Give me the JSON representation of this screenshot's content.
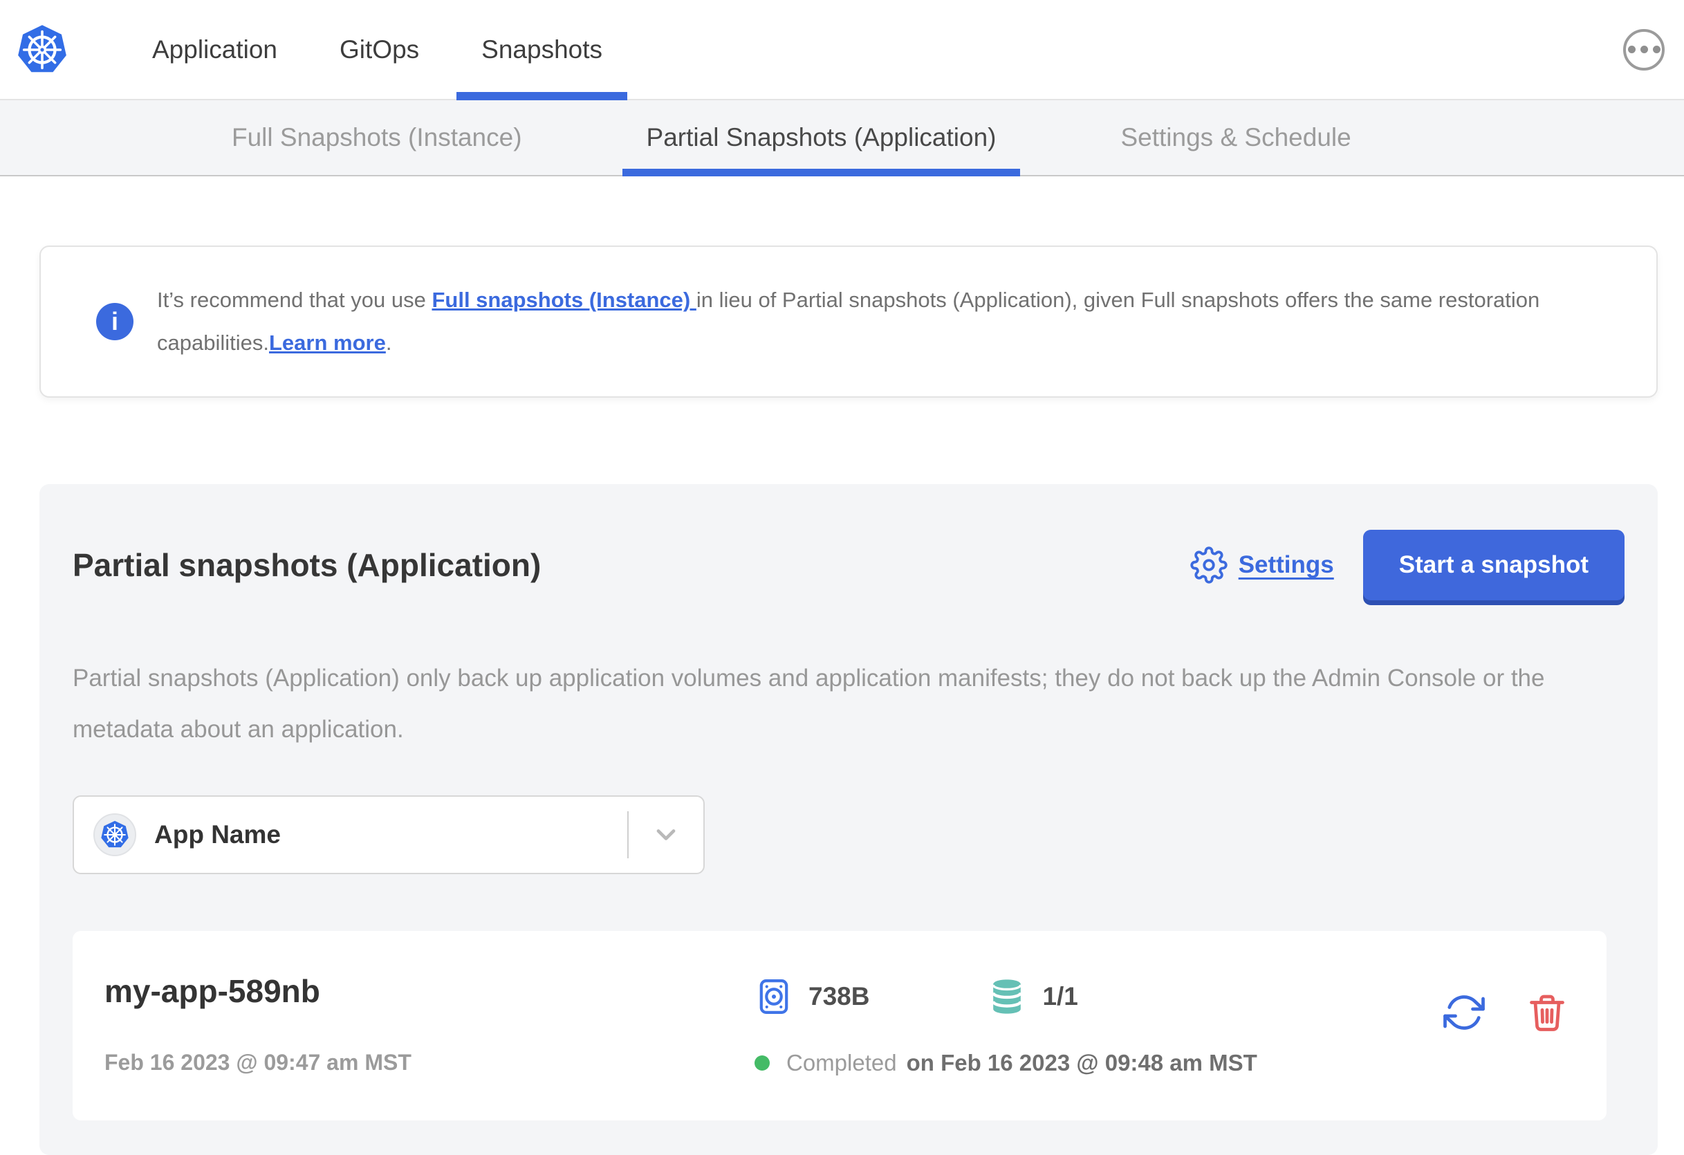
{
  "header": {
    "logo": "kubernetes",
    "nav": [
      {
        "label": "Application",
        "active": false
      },
      {
        "label": "GitOps",
        "active": false
      },
      {
        "label": "Snapshots",
        "active": true
      }
    ]
  },
  "subnav": {
    "tabs": [
      {
        "label": "Full Snapshots (Instance)",
        "active": false
      },
      {
        "label": "Partial Snapshots (Application)",
        "active": true
      },
      {
        "label": "Settings & Schedule",
        "active": false
      }
    ]
  },
  "banner": {
    "text_start": "It’s recommend that you use ",
    "link_full_snapshots": "Full snapshots (Instance) ",
    "text_middle": "in lieu of Partial snapshots (Application), given Full snapshots offers the same restoration capabilities.",
    "link_learn_more": "Learn more",
    "text_end": "."
  },
  "panel": {
    "title": "Partial snapshots (Application)",
    "settings_label": "Settings",
    "start_snapshot_label": "Start a snapshot",
    "description": "Partial snapshots (Application) only back up application volumes and application manifests; they do not back up the Admin Console or the metadata about an application.",
    "app_selector": {
      "selected": "App Name"
    },
    "snapshots": [
      {
        "name": "my-app-589nb",
        "started": "Feb 16 2023 @ 09:47 am MST",
        "size": "738B",
        "volume_count": "1/1",
        "status": "Completed",
        "finished": "on Feb 16 2023 @ 09:48 am MST"
      }
    ]
  },
  "colors": {
    "primary_blue": "#3b6ade",
    "kubernetes_blue": "#326de6",
    "volume_teal": "#65c0b5",
    "success_green": "#44bb66",
    "danger_red": "#e65e5e"
  }
}
